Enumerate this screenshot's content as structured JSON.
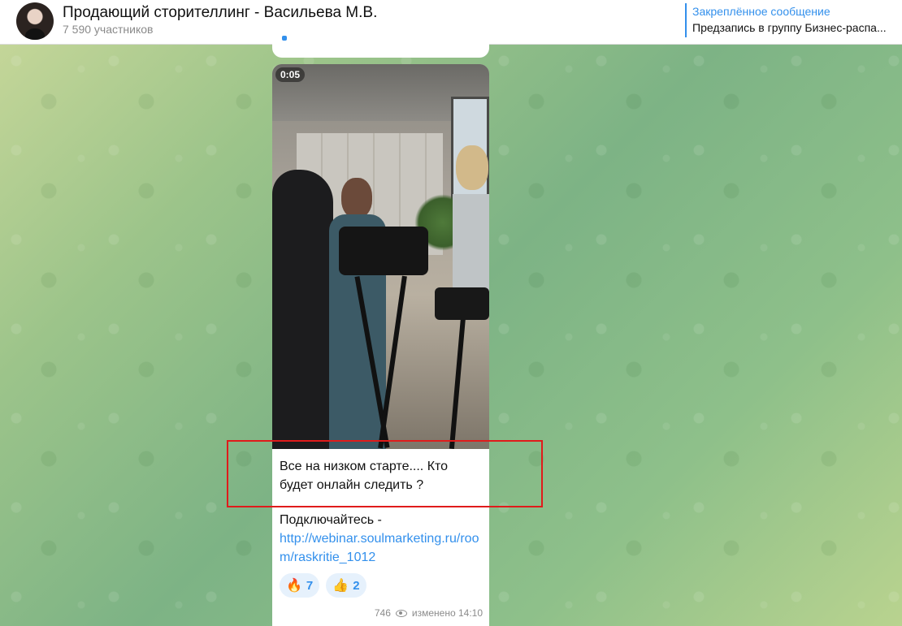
{
  "header": {
    "title": "Продающий сторителлинг - Васильева М.В.",
    "subtitle": "7 590 участников",
    "pinned_title": "Закреплённое сообщение",
    "pinned_text": "Предзапись в группу Бизнес-распа..."
  },
  "message": {
    "video_duration": "0:05",
    "caption": "Все на низком  старте.... Кто будет онлайн следить ?",
    "subscribe_text": "Подключайтесь -",
    "link": "http://webinar.soulmarketing.ru/room/raskritie_1012",
    "reactions": [
      {
        "emoji": "🔥",
        "count": "7"
      },
      {
        "emoji": "👍",
        "count": "2"
      }
    ],
    "views": "746",
    "edited": "изменено 14:10"
  },
  "colors": {
    "accent": "#3390ec",
    "highlight": "#e01b1b"
  },
  "icons": {
    "views": "eye-icon",
    "avatar": "avatar"
  }
}
